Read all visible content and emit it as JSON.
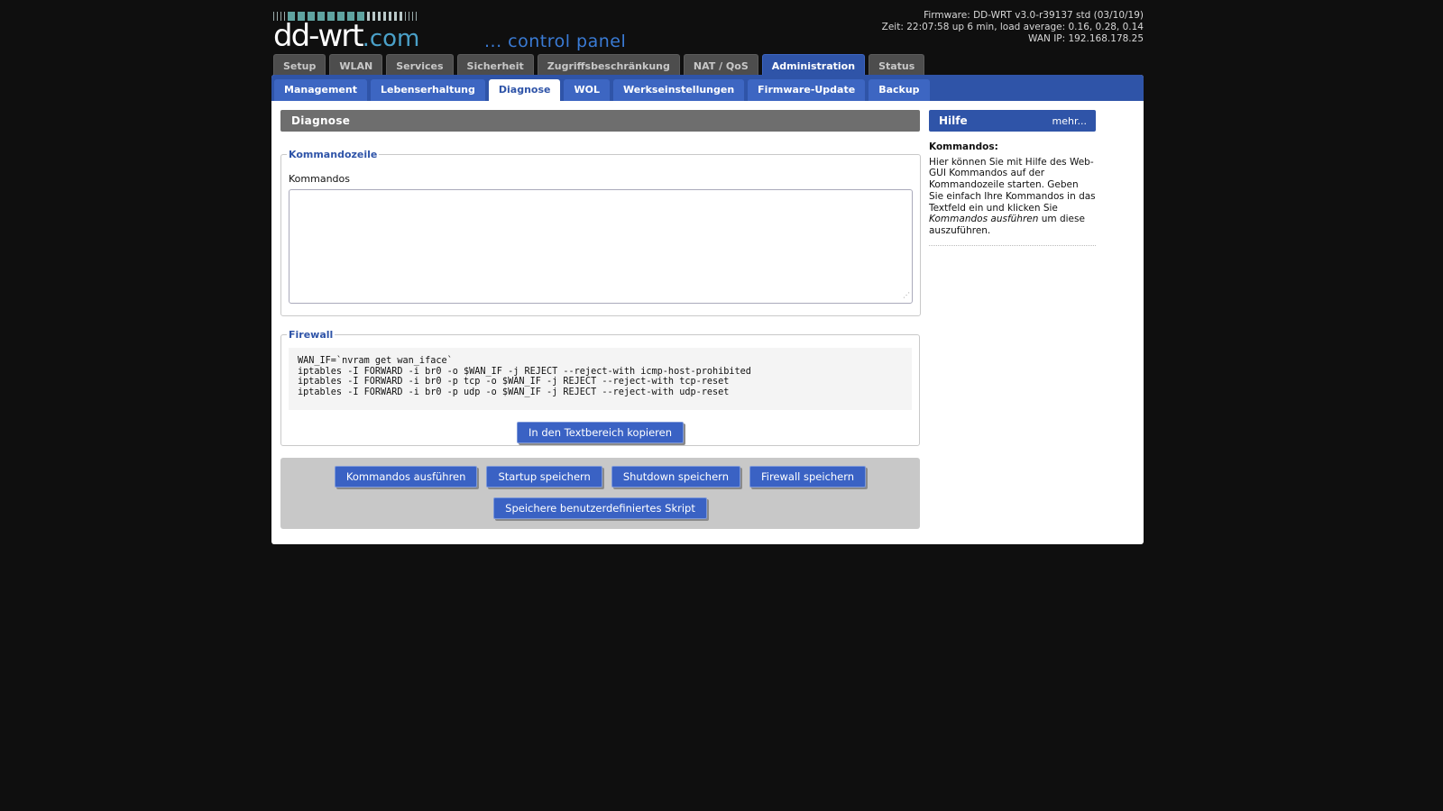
{
  "header": {
    "logo_main": "dd-wrt",
    "logo_dot": ".com",
    "control_panel": "... control panel",
    "firmware": "Firmware: DD-WRT v3.0-r39137 std (03/10/19)",
    "time": "Zeit: 22:07:58 up 6 min, load average: 0.16, 0.28, 0.14",
    "wan_ip": "WAN IP: 192.168.178.25"
  },
  "main_tabs": [
    {
      "label": "Setup"
    },
    {
      "label": "WLAN"
    },
    {
      "label": "Services"
    },
    {
      "label": "Sicherheit"
    },
    {
      "label": "Zugriffsbeschränkung"
    },
    {
      "label": "NAT / QoS"
    },
    {
      "label": "Administration",
      "active": true
    },
    {
      "label": "Status"
    }
  ],
  "sub_tabs": [
    {
      "label": "Management"
    },
    {
      "label": "Lebenserhaltung"
    },
    {
      "label": "Diagnose",
      "active": true
    },
    {
      "label": "WOL"
    },
    {
      "label": "Werkseinstellungen"
    },
    {
      "label": "Firmware-Update"
    },
    {
      "label": "Backup"
    }
  ],
  "page_title": "Diagnose",
  "command_section": {
    "legend": "Kommandozeile",
    "label": "Kommandos",
    "value": ""
  },
  "firewall_section": {
    "legend": "Firewall",
    "code": "WAN_IF=`nvram get wan_iface`\niptables -I FORWARD -i br0 -o $WAN_IF -j REJECT --reject-with icmp-host-prohibited\niptables -I FORWARD -i br0 -p tcp -o $WAN_IF -j REJECT --reject-with tcp-reset\niptables -I FORWARD -i br0 -p udp -o $WAN_IF -j REJECT --reject-with udp-reset",
    "copy_button": "In den Textbereich kopieren"
  },
  "actions": {
    "run": "Kommandos ausführen",
    "save_startup": "Startup speichern",
    "save_shutdown": "Shutdown speichern",
    "save_firewall": "Firewall speichern",
    "save_custom": "Speichere benutzerdefiniertes Skript"
  },
  "help": {
    "title": "Hilfe",
    "more": "mehr...",
    "heading": "Kommandos:",
    "text_before": "Hier können Sie mit Hilfe des Web-GUI Kommandos auf der Kommandozeile starten. Geben Sie einfach Ihre Kommandos in das Textfeld ein und klicken Sie ",
    "text_em": "Kommandos ausführen",
    "text_after": " um diese auszuführen."
  },
  "colors": {
    "accent_blue": "#2f54a8",
    "button_blue": "#3a62c4",
    "tab_gray": "#4d4d4d",
    "page_bg": "#0f0f0f"
  }
}
